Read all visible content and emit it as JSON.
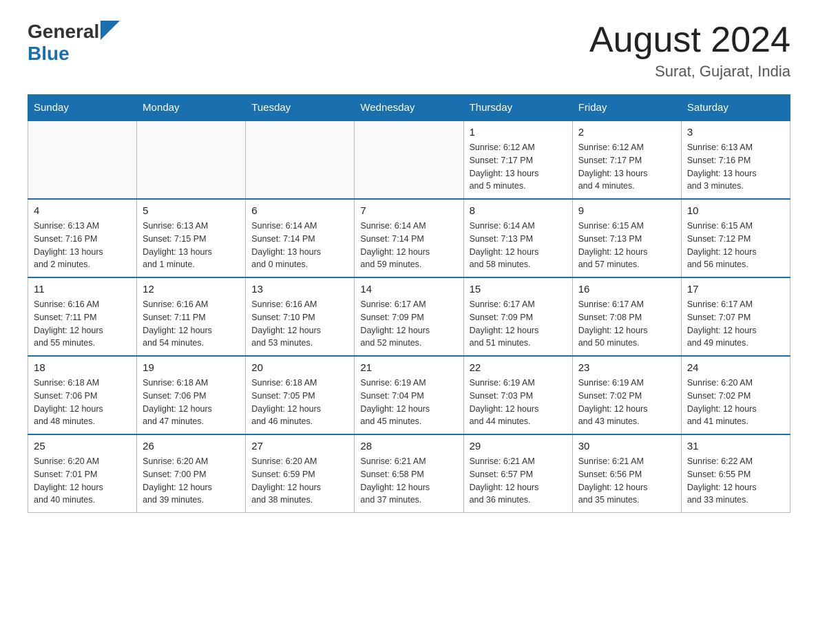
{
  "header": {
    "logo_general": "General",
    "logo_blue": "Blue",
    "month_year": "August 2024",
    "location": "Surat, Gujarat, India"
  },
  "weekdays": [
    "Sunday",
    "Monday",
    "Tuesday",
    "Wednesday",
    "Thursday",
    "Friday",
    "Saturday"
  ],
  "weeks": [
    [
      {
        "day": "",
        "info": ""
      },
      {
        "day": "",
        "info": ""
      },
      {
        "day": "",
        "info": ""
      },
      {
        "day": "",
        "info": ""
      },
      {
        "day": "1",
        "info": "Sunrise: 6:12 AM\nSunset: 7:17 PM\nDaylight: 13 hours\nand 5 minutes."
      },
      {
        "day": "2",
        "info": "Sunrise: 6:12 AM\nSunset: 7:17 PM\nDaylight: 13 hours\nand 4 minutes."
      },
      {
        "day": "3",
        "info": "Sunrise: 6:13 AM\nSunset: 7:16 PM\nDaylight: 13 hours\nand 3 minutes."
      }
    ],
    [
      {
        "day": "4",
        "info": "Sunrise: 6:13 AM\nSunset: 7:16 PM\nDaylight: 13 hours\nand 2 minutes."
      },
      {
        "day": "5",
        "info": "Sunrise: 6:13 AM\nSunset: 7:15 PM\nDaylight: 13 hours\nand 1 minute."
      },
      {
        "day": "6",
        "info": "Sunrise: 6:14 AM\nSunset: 7:14 PM\nDaylight: 13 hours\nand 0 minutes."
      },
      {
        "day": "7",
        "info": "Sunrise: 6:14 AM\nSunset: 7:14 PM\nDaylight: 12 hours\nand 59 minutes."
      },
      {
        "day": "8",
        "info": "Sunrise: 6:14 AM\nSunset: 7:13 PM\nDaylight: 12 hours\nand 58 minutes."
      },
      {
        "day": "9",
        "info": "Sunrise: 6:15 AM\nSunset: 7:13 PM\nDaylight: 12 hours\nand 57 minutes."
      },
      {
        "day": "10",
        "info": "Sunrise: 6:15 AM\nSunset: 7:12 PM\nDaylight: 12 hours\nand 56 minutes."
      }
    ],
    [
      {
        "day": "11",
        "info": "Sunrise: 6:16 AM\nSunset: 7:11 PM\nDaylight: 12 hours\nand 55 minutes."
      },
      {
        "day": "12",
        "info": "Sunrise: 6:16 AM\nSunset: 7:11 PM\nDaylight: 12 hours\nand 54 minutes."
      },
      {
        "day": "13",
        "info": "Sunrise: 6:16 AM\nSunset: 7:10 PM\nDaylight: 12 hours\nand 53 minutes."
      },
      {
        "day": "14",
        "info": "Sunrise: 6:17 AM\nSunset: 7:09 PM\nDaylight: 12 hours\nand 52 minutes."
      },
      {
        "day": "15",
        "info": "Sunrise: 6:17 AM\nSunset: 7:09 PM\nDaylight: 12 hours\nand 51 minutes."
      },
      {
        "day": "16",
        "info": "Sunrise: 6:17 AM\nSunset: 7:08 PM\nDaylight: 12 hours\nand 50 minutes."
      },
      {
        "day": "17",
        "info": "Sunrise: 6:17 AM\nSunset: 7:07 PM\nDaylight: 12 hours\nand 49 minutes."
      }
    ],
    [
      {
        "day": "18",
        "info": "Sunrise: 6:18 AM\nSunset: 7:06 PM\nDaylight: 12 hours\nand 48 minutes."
      },
      {
        "day": "19",
        "info": "Sunrise: 6:18 AM\nSunset: 7:06 PM\nDaylight: 12 hours\nand 47 minutes."
      },
      {
        "day": "20",
        "info": "Sunrise: 6:18 AM\nSunset: 7:05 PM\nDaylight: 12 hours\nand 46 minutes."
      },
      {
        "day": "21",
        "info": "Sunrise: 6:19 AM\nSunset: 7:04 PM\nDaylight: 12 hours\nand 45 minutes."
      },
      {
        "day": "22",
        "info": "Sunrise: 6:19 AM\nSunset: 7:03 PM\nDaylight: 12 hours\nand 44 minutes."
      },
      {
        "day": "23",
        "info": "Sunrise: 6:19 AM\nSunset: 7:02 PM\nDaylight: 12 hours\nand 43 minutes."
      },
      {
        "day": "24",
        "info": "Sunrise: 6:20 AM\nSunset: 7:02 PM\nDaylight: 12 hours\nand 41 minutes."
      }
    ],
    [
      {
        "day": "25",
        "info": "Sunrise: 6:20 AM\nSunset: 7:01 PM\nDaylight: 12 hours\nand 40 minutes."
      },
      {
        "day": "26",
        "info": "Sunrise: 6:20 AM\nSunset: 7:00 PM\nDaylight: 12 hours\nand 39 minutes."
      },
      {
        "day": "27",
        "info": "Sunrise: 6:20 AM\nSunset: 6:59 PM\nDaylight: 12 hours\nand 38 minutes."
      },
      {
        "day": "28",
        "info": "Sunrise: 6:21 AM\nSunset: 6:58 PM\nDaylight: 12 hours\nand 37 minutes."
      },
      {
        "day": "29",
        "info": "Sunrise: 6:21 AM\nSunset: 6:57 PM\nDaylight: 12 hours\nand 36 minutes."
      },
      {
        "day": "30",
        "info": "Sunrise: 6:21 AM\nSunset: 6:56 PM\nDaylight: 12 hours\nand 35 minutes."
      },
      {
        "day": "31",
        "info": "Sunrise: 6:22 AM\nSunset: 6:55 PM\nDaylight: 12 hours\nand 33 minutes."
      }
    ]
  ]
}
